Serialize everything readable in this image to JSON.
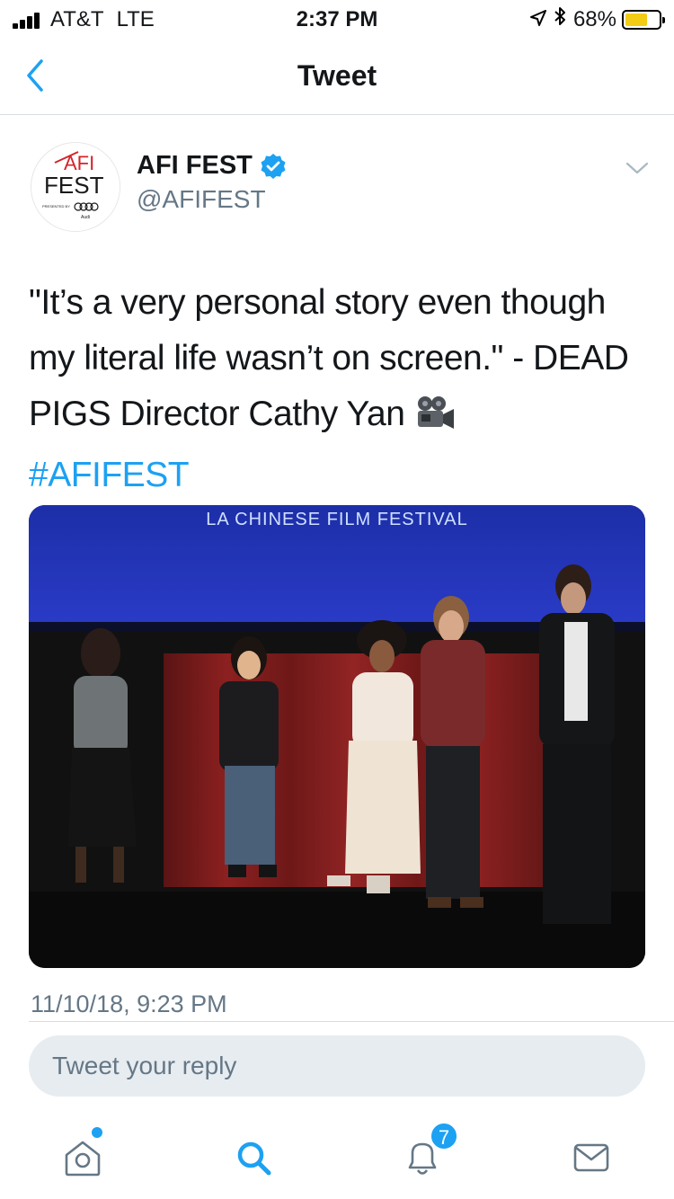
{
  "status_bar": {
    "carrier": "AT&T",
    "network": "LTE",
    "time": "2:37 PM",
    "battery_percent": "68%",
    "battery_level": 0.68
  },
  "nav": {
    "title": "Tweet"
  },
  "author": {
    "name": "AFI FEST",
    "handle": "@AFIFEST",
    "verified": true,
    "avatar_logo": "AFI FEST presented by Audi"
  },
  "tweet": {
    "text_part1": "\"It’s a very personal story even though my literal life wasn’t on screen.\" - DEAD PIGS Director Cathy Yan ",
    "hashtag": "#AFIFEST",
    "timestamp": "11/10/18, 9:23 PM"
  },
  "photo": {
    "banner_text": "LA CHINESE FILM FESTIVAL"
  },
  "reply": {
    "placeholder": "Tweet your reply"
  },
  "tabbar": {
    "notifications_badge": "7"
  },
  "colors": {
    "accent": "#1da1f2",
    "secondary_text": "#657786"
  }
}
